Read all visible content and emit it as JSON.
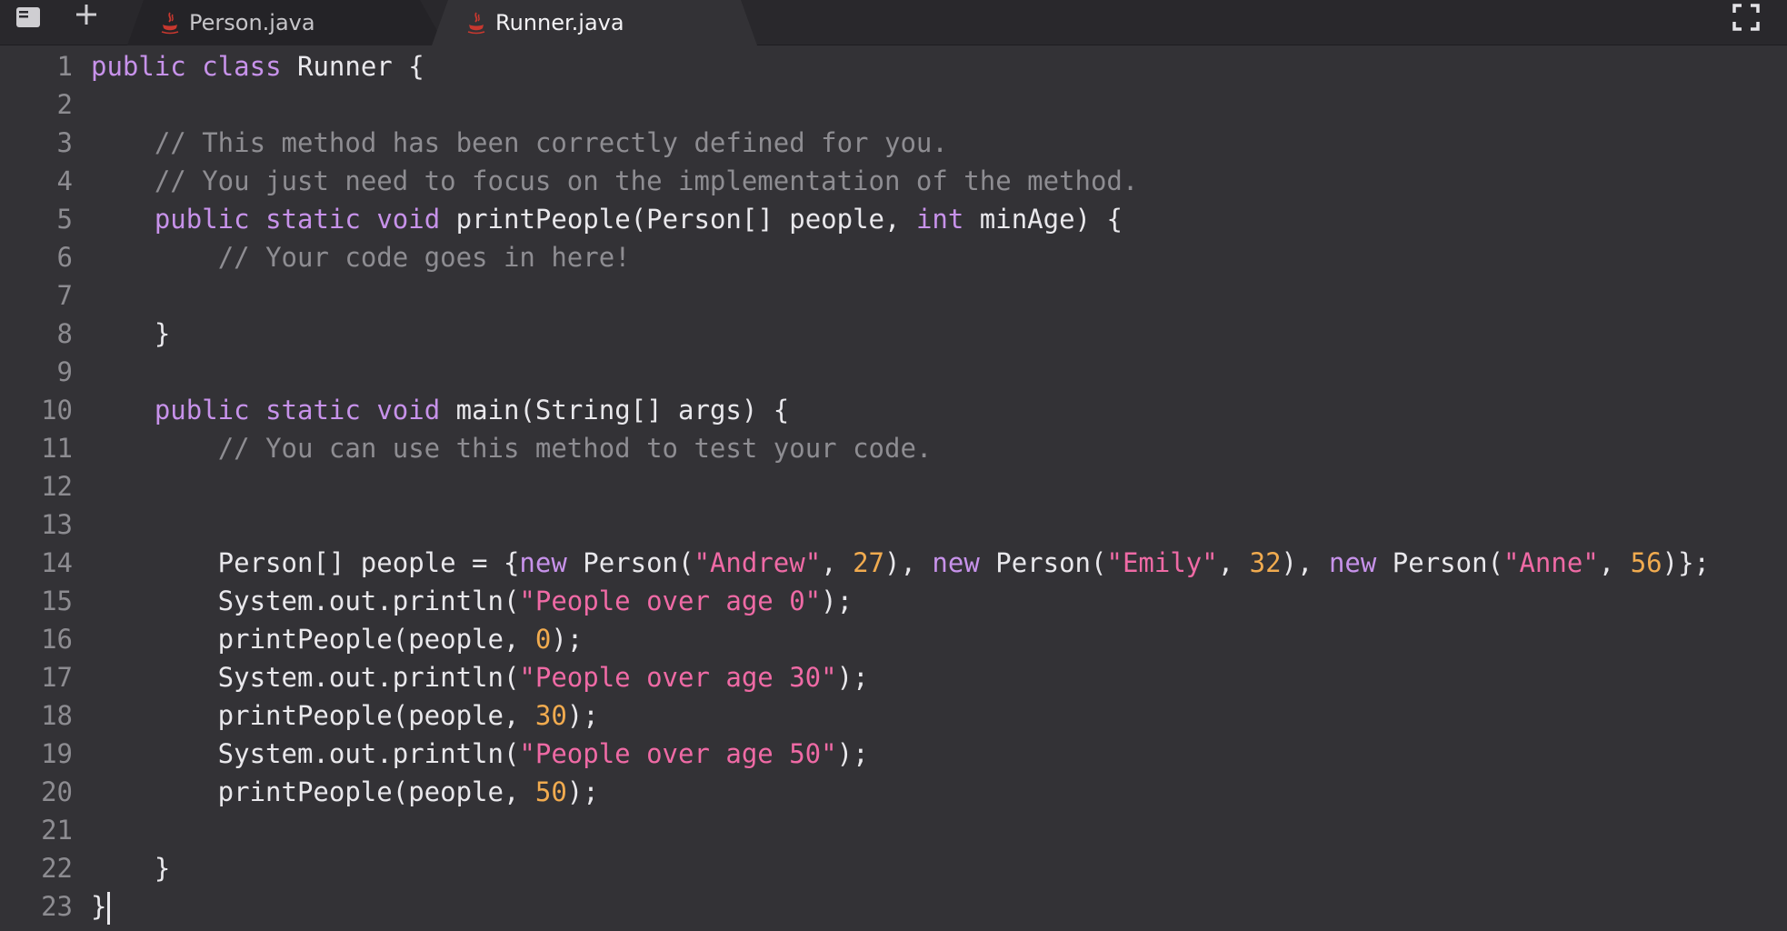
{
  "tabs": [
    {
      "label": "Person.java",
      "icon": "java-icon",
      "active": false
    },
    {
      "label": "Runner.java",
      "icon": "java-icon",
      "active": true
    }
  ],
  "colors": {
    "keyword": "#c792ea",
    "comment": "#8e8d92",
    "string": "#ef6aa5",
    "number": "#f1ab4f",
    "text": "#e9e8ec",
    "background": "#333236",
    "java_icon": "#c8382f"
  },
  "editor": {
    "lines": [
      [
        {
          "t": "kw",
          "v": "public"
        },
        {
          "t": "p",
          "v": " "
        },
        {
          "t": "kw",
          "v": "class"
        },
        {
          "t": "p",
          "v": " Runner {"
        }
      ],
      [],
      [
        {
          "t": "p",
          "v": "    "
        },
        {
          "t": "cm",
          "v": "// This method has been correctly defined for you."
        }
      ],
      [
        {
          "t": "p",
          "v": "    "
        },
        {
          "t": "cm",
          "v": "// You just need to focus on the implementation of the method."
        }
      ],
      [
        {
          "t": "p",
          "v": "    "
        },
        {
          "t": "kw",
          "v": "public"
        },
        {
          "t": "p",
          "v": " "
        },
        {
          "t": "kw",
          "v": "static"
        },
        {
          "t": "p",
          "v": " "
        },
        {
          "t": "kw",
          "v": "void"
        },
        {
          "t": "p",
          "v": " printPeople(Person[] people, "
        },
        {
          "t": "kw",
          "v": "int"
        },
        {
          "t": "p",
          "v": " minAge) {"
        }
      ],
      [
        {
          "t": "p",
          "v": "        "
        },
        {
          "t": "cm",
          "v": "// Your code goes in here!"
        }
      ],
      [],
      [
        {
          "t": "p",
          "v": "    }"
        }
      ],
      [],
      [
        {
          "t": "p",
          "v": "    "
        },
        {
          "t": "kw",
          "v": "public"
        },
        {
          "t": "p",
          "v": " "
        },
        {
          "t": "kw",
          "v": "static"
        },
        {
          "t": "p",
          "v": " "
        },
        {
          "t": "kw",
          "v": "void"
        },
        {
          "t": "p",
          "v": " main(String[] args) {"
        }
      ],
      [
        {
          "t": "p",
          "v": "        "
        },
        {
          "t": "cm",
          "v": "// You can use this method to test your code."
        }
      ],
      [],
      [],
      [
        {
          "t": "p",
          "v": "        Person[] people = {"
        },
        {
          "t": "kw",
          "v": "new"
        },
        {
          "t": "p",
          "v": " Person("
        },
        {
          "t": "str",
          "v": "\"Andrew\""
        },
        {
          "t": "p",
          "v": ", "
        },
        {
          "t": "num",
          "v": "27"
        },
        {
          "t": "p",
          "v": "), "
        },
        {
          "t": "kw",
          "v": "new"
        },
        {
          "t": "p",
          "v": " Person("
        },
        {
          "t": "str",
          "v": "\"Emily\""
        },
        {
          "t": "p",
          "v": ", "
        },
        {
          "t": "num",
          "v": "32"
        },
        {
          "t": "p",
          "v": "), "
        },
        {
          "t": "kw",
          "v": "new"
        },
        {
          "t": "p",
          "v": " Person("
        },
        {
          "t": "str",
          "v": "\"Anne\""
        },
        {
          "t": "p",
          "v": ", "
        },
        {
          "t": "num",
          "v": "56"
        },
        {
          "t": "p",
          "v": ")};"
        }
      ],
      [
        {
          "t": "p",
          "v": "        System.out.println("
        },
        {
          "t": "str",
          "v": "\"People over age 0\""
        },
        {
          "t": "p",
          "v": ");"
        }
      ],
      [
        {
          "t": "p",
          "v": "        printPeople(people, "
        },
        {
          "t": "num",
          "v": "0"
        },
        {
          "t": "p",
          "v": ");"
        }
      ],
      [
        {
          "t": "p",
          "v": "        System.out.println("
        },
        {
          "t": "str",
          "v": "\"People over age 30\""
        },
        {
          "t": "p",
          "v": ");"
        }
      ],
      [
        {
          "t": "p",
          "v": "        printPeople(people, "
        },
        {
          "t": "num",
          "v": "30"
        },
        {
          "t": "p",
          "v": ");"
        }
      ],
      [
        {
          "t": "p",
          "v": "        System.out.println("
        },
        {
          "t": "str",
          "v": "\"People over age 50\""
        },
        {
          "t": "p",
          "v": ");"
        }
      ],
      [
        {
          "t": "p",
          "v": "        printPeople(people, "
        },
        {
          "t": "num",
          "v": "50"
        },
        {
          "t": "p",
          "v": ");"
        }
      ],
      [],
      [
        {
          "t": "p",
          "v": "    }"
        }
      ],
      [
        {
          "t": "p",
          "v": "}"
        }
      ]
    ],
    "cursor_line": 23
  }
}
